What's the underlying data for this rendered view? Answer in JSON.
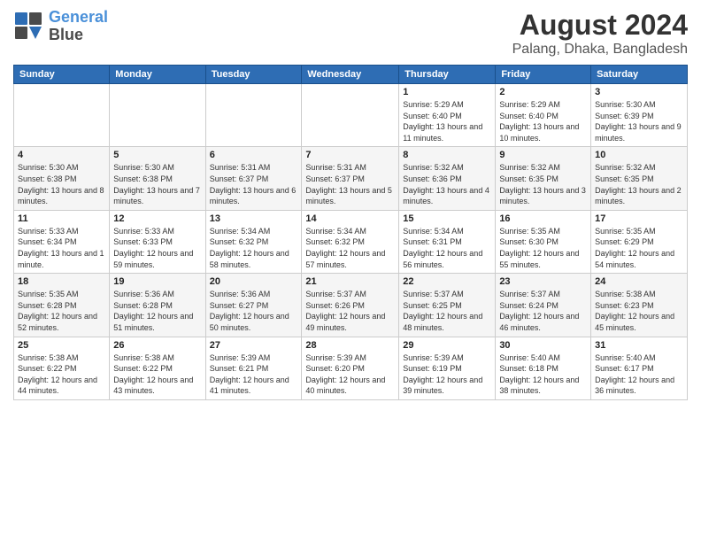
{
  "logo": {
    "line1": "General",
    "line2": "Blue"
  },
  "title": "August 2024",
  "subtitle": "Palang, Dhaka, Bangladesh",
  "header_days": [
    "Sunday",
    "Monday",
    "Tuesday",
    "Wednesday",
    "Thursday",
    "Friday",
    "Saturday"
  ],
  "weeks": [
    [
      {
        "day": "",
        "info": ""
      },
      {
        "day": "",
        "info": ""
      },
      {
        "day": "",
        "info": ""
      },
      {
        "day": "",
        "info": ""
      },
      {
        "day": "1",
        "info": "Sunrise: 5:29 AM\nSunset: 6:40 PM\nDaylight: 13 hours\nand 11 minutes."
      },
      {
        "day": "2",
        "info": "Sunrise: 5:29 AM\nSunset: 6:40 PM\nDaylight: 13 hours\nand 10 minutes."
      },
      {
        "day": "3",
        "info": "Sunrise: 5:30 AM\nSunset: 6:39 PM\nDaylight: 13 hours\nand 9 minutes."
      }
    ],
    [
      {
        "day": "4",
        "info": "Sunrise: 5:30 AM\nSunset: 6:38 PM\nDaylight: 13 hours\nand 8 minutes."
      },
      {
        "day": "5",
        "info": "Sunrise: 5:30 AM\nSunset: 6:38 PM\nDaylight: 13 hours\nand 7 minutes."
      },
      {
        "day": "6",
        "info": "Sunrise: 5:31 AM\nSunset: 6:37 PM\nDaylight: 13 hours\nand 6 minutes."
      },
      {
        "day": "7",
        "info": "Sunrise: 5:31 AM\nSunset: 6:37 PM\nDaylight: 13 hours\nand 5 minutes."
      },
      {
        "day": "8",
        "info": "Sunrise: 5:32 AM\nSunset: 6:36 PM\nDaylight: 13 hours\nand 4 minutes."
      },
      {
        "day": "9",
        "info": "Sunrise: 5:32 AM\nSunset: 6:35 PM\nDaylight: 13 hours\nand 3 minutes."
      },
      {
        "day": "10",
        "info": "Sunrise: 5:32 AM\nSunset: 6:35 PM\nDaylight: 13 hours\nand 2 minutes."
      }
    ],
    [
      {
        "day": "11",
        "info": "Sunrise: 5:33 AM\nSunset: 6:34 PM\nDaylight: 13 hours\nand 1 minute."
      },
      {
        "day": "12",
        "info": "Sunrise: 5:33 AM\nSunset: 6:33 PM\nDaylight: 12 hours\nand 59 minutes."
      },
      {
        "day": "13",
        "info": "Sunrise: 5:34 AM\nSunset: 6:32 PM\nDaylight: 12 hours\nand 58 minutes."
      },
      {
        "day": "14",
        "info": "Sunrise: 5:34 AM\nSunset: 6:32 PM\nDaylight: 12 hours\nand 57 minutes."
      },
      {
        "day": "15",
        "info": "Sunrise: 5:34 AM\nSunset: 6:31 PM\nDaylight: 12 hours\nand 56 minutes."
      },
      {
        "day": "16",
        "info": "Sunrise: 5:35 AM\nSunset: 6:30 PM\nDaylight: 12 hours\nand 55 minutes."
      },
      {
        "day": "17",
        "info": "Sunrise: 5:35 AM\nSunset: 6:29 PM\nDaylight: 12 hours\nand 54 minutes."
      }
    ],
    [
      {
        "day": "18",
        "info": "Sunrise: 5:35 AM\nSunset: 6:28 PM\nDaylight: 12 hours\nand 52 minutes."
      },
      {
        "day": "19",
        "info": "Sunrise: 5:36 AM\nSunset: 6:28 PM\nDaylight: 12 hours\nand 51 minutes."
      },
      {
        "day": "20",
        "info": "Sunrise: 5:36 AM\nSunset: 6:27 PM\nDaylight: 12 hours\nand 50 minutes."
      },
      {
        "day": "21",
        "info": "Sunrise: 5:37 AM\nSunset: 6:26 PM\nDaylight: 12 hours\nand 49 minutes."
      },
      {
        "day": "22",
        "info": "Sunrise: 5:37 AM\nSunset: 6:25 PM\nDaylight: 12 hours\nand 48 minutes."
      },
      {
        "day": "23",
        "info": "Sunrise: 5:37 AM\nSunset: 6:24 PM\nDaylight: 12 hours\nand 46 minutes."
      },
      {
        "day": "24",
        "info": "Sunrise: 5:38 AM\nSunset: 6:23 PM\nDaylight: 12 hours\nand 45 minutes."
      }
    ],
    [
      {
        "day": "25",
        "info": "Sunrise: 5:38 AM\nSunset: 6:22 PM\nDaylight: 12 hours\nand 44 minutes."
      },
      {
        "day": "26",
        "info": "Sunrise: 5:38 AM\nSunset: 6:22 PM\nDaylight: 12 hours\nand 43 minutes."
      },
      {
        "day": "27",
        "info": "Sunrise: 5:39 AM\nSunset: 6:21 PM\nDaylight: 12 hours\nand 41 minutes."
      },
      {
        "day": "28",
        "info": "Sunrise: 5:39 AM\nSunset: 6:20 PM\nDaylight: 12 hours\nand 40 minutes."
      },
      {
        "day": "29",
        "info": "Sunrise: 5:39 AM\nSunset: 6:19 PM\nDaylight: 12 hours\nand 39 minutes."
      },
      {
        "day": "30",
        "info": "Sunrise: 5:40 AM\nSunset: 6:18 PM\nDaylight: 12 hours\nand 38 minutes."
      },
      {
        "day": "31",
        "info": "Sunrise: 5:40 AM\nSunset: 6:17 PM\nDaylight: 12 hours\nand 36 minutes."
      }
    ]
  ]
}
